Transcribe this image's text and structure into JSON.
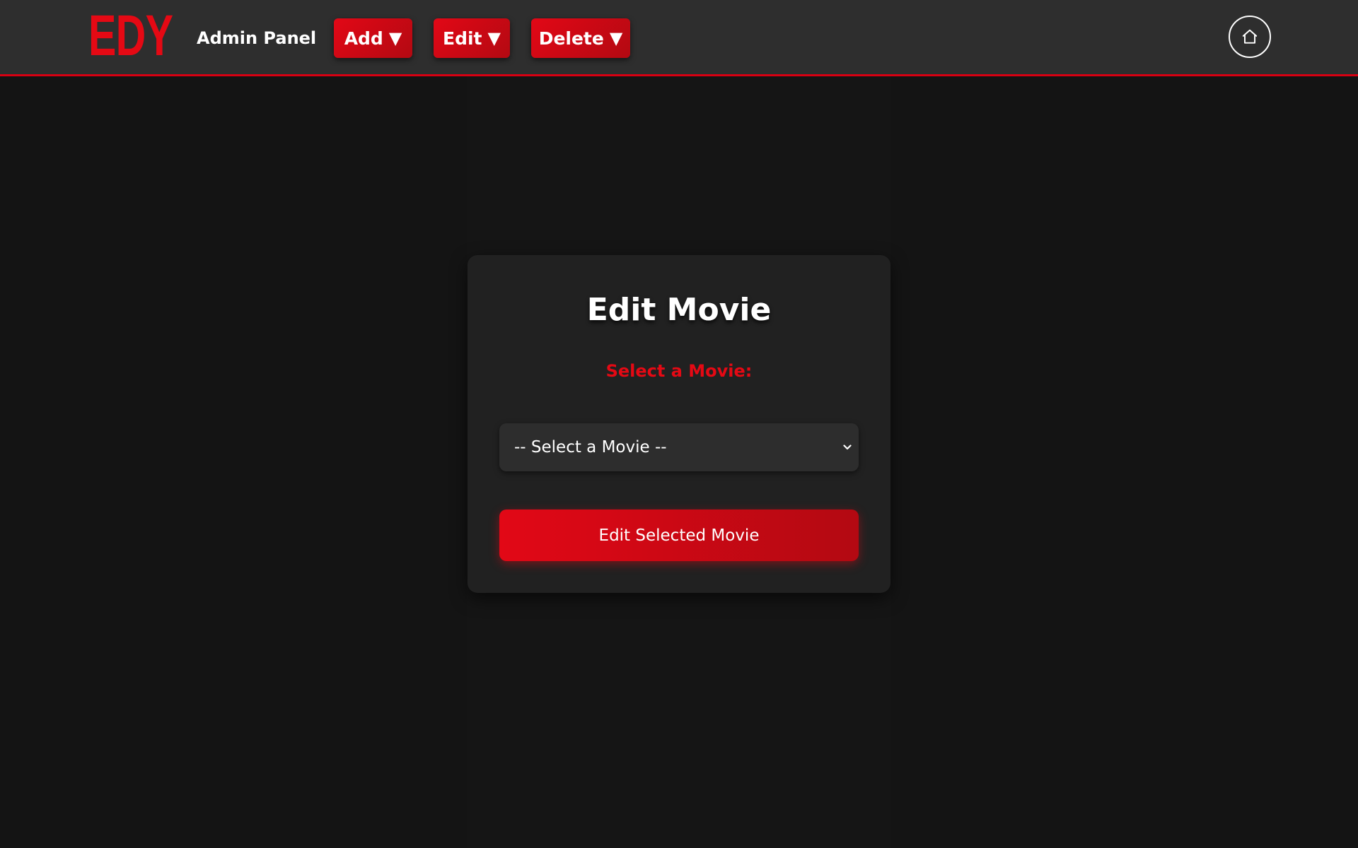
{
  "colors": {
    "brand_red": "#e50914",
    "topbar_bg": "#2e2e2e",
    "page_bg": "#141414",
    "card_bg": "#212121",
    "select_bg": "#2d2d2d"
  },
  "header": {
    "logo": "EDY",
    "title": "Admin Panel",
    "menus": [
      {
        "label": "Add",
        "caret": "▼"
      },
      {
        "label": "Edit",
        "caret": "▼"
      },
      {
        "label": "Delete",
        "caret": "▼"
      }
    ],
    "home_icon": "home-icon"
  },
  "form": {
    "title": "Edit Movie",
    "select_label": "Select a Movie:",
    "select_value": "-- Select a Movie --",
    "select_icon": "chevron-down-icon",
    "submit_label": "Edit Selected Movie"
  }
}
